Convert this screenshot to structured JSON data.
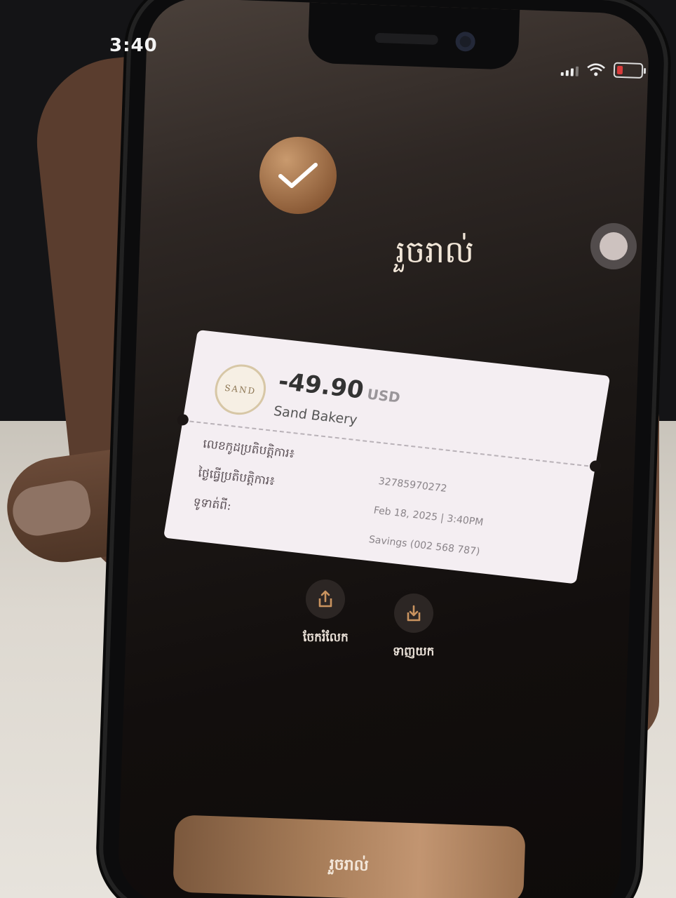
{
  "status_bar": {
    "time": "3:40"
  },
  "success": {
    "title": "រួចរាល់"
  },
  "receipt": {
    "logo_text": "SAND",
    "amount": "-49.90",
    "currency": "USD",
    "merchant": "Sand Bakery",
    "fields": [
      {
        "label": "លេខកូដប្រតិបត្តិការ៖",
        "value": "32785970272"
      },
      {
        "label": "ថ្ងៃធ្វើប្រតិបត្តិការ៖",
        "value": "Feb 18, 2025 | 3:40PM"
      },
      {
        "label": "ទូទាត់ពី:",
        "value": "Savings (002 568 787)"
      }
    ]
  },
  "actions": {
    "share_label": "ចែករំលែក",
    "download_label": "ទាញយក"
  },
  "done_button": {
    "label": "រួចរាល់"
  },
  "colors": {
    "accent": "#a67c58",
    "receipt_bg": "#f4eef2"
  }
}
